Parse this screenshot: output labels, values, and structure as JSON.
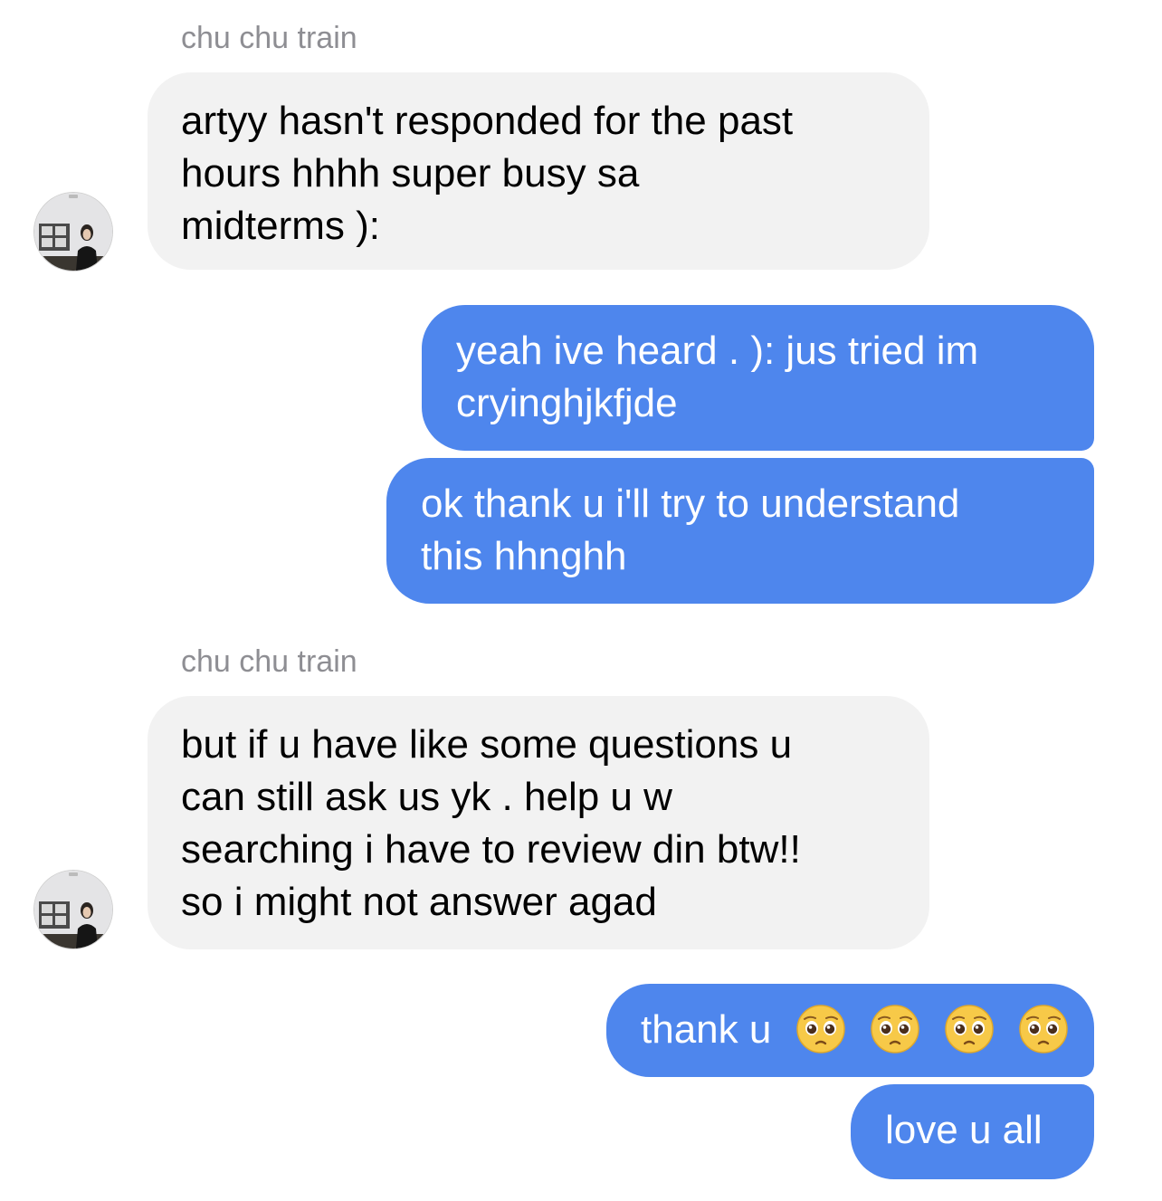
{
  "conversation": {
    "messages": [
      {
        "type": "sender_name",
        "text": "chu chu train"
      },
      {
        "type": "incoming",
        "text": "artyy hasn't responded for the past\nhours hhhh super busy sa\nmidterms ):"
      },
      {
        "type": "outgoing",
        "text": "yeah ive heard . ): jus tried im\ncryinghjkfjde"
      },
      {
        "type": "outgoing",
        "text": "ok thank u i'll try to understand\nthis hhnghh"
      },
      {
        "type": "sender_name",
        "text": "chu chu train"
      },
      {
        "type": "incoming",
        "text": "but if u have like some questions u\ncan still ask us yk . help u w\nsearching i have to review din btw!!\nso i might not answer agad"
      },
      {
        "type": "outgoing",
        "text": "thank u",
        "emoji": [
          "pleading-face",
          "pleading-face",
          "pleading-face",
          "pleading-face"
        ]
      },
      {
        "type": "outgoing",
        "text": "love u all"
      }
    ]
  },
  "colors": {
    "outgoing_bubble": "#4e86ed",
    "incoming_bubble": "#f2f2f2",
    "sender_name": "#8e8e93"
  }
}
